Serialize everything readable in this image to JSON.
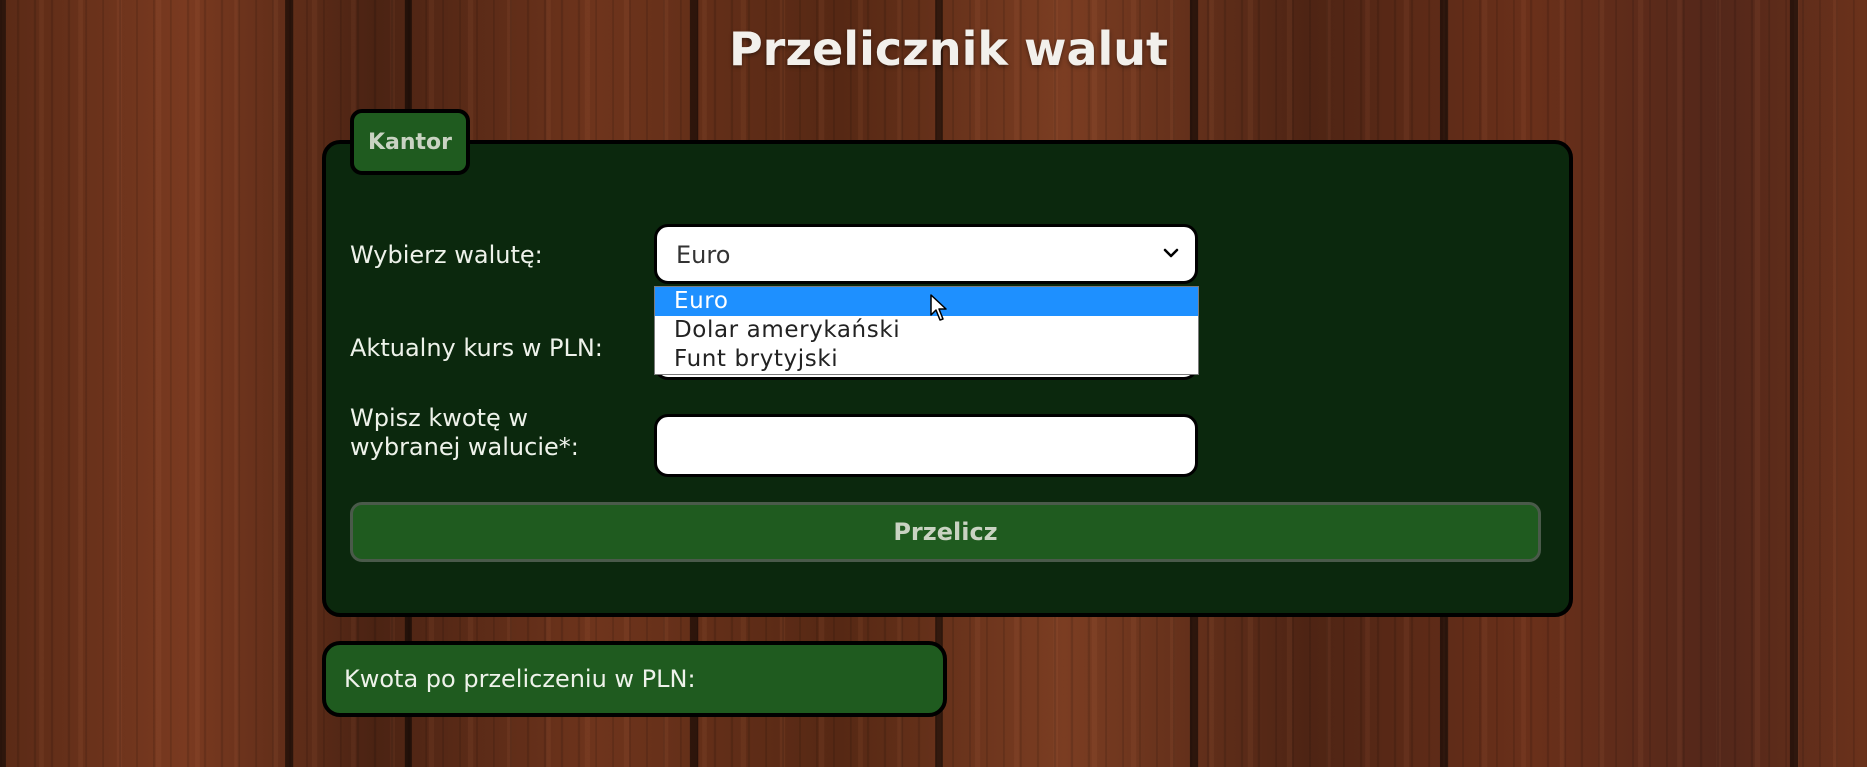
{
  "page": {
    "title": "Przelicznik walut"
  },
  "card": {
    "tab_label": "Kantor",
    "currency_label": "Wybierz walutę:",
    "currency_selected": "Euro",
    "currency_options": [
      {
        "label": "Euro",
        "highlighted": true
      },
      {
        "label": "Dolar amerykański",
        "highlighted": false
      },
      {
        "label": "Funt brytyjski",
        "highlighted": false
      }
    ],
    "rate_label": "Aktualny kurs w PLN:",
    "amount_label_line1": "Wpisz kwotę w",
    "amount_label_line2": "wybranej walucie*:",
    "amount_value": "",
    "convert_button": "Przelicz"
  },
  "result": {
    "label": "Kwota po przeliczeniu w PLN:"
  },
  "icons": {
    "select_arrow": "chevron-down-icon",
    "cursor": "mouse-pointer-icon"
  },
  "colors": {
    "panel": "#0b280d",
    "accent_green": "#1f5b1f",
    "highlight": "#1e90ff"
  }
}
